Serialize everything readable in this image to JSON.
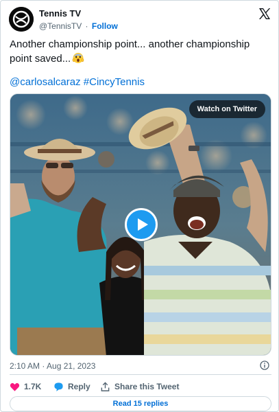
{
  "author": {
    "name": "Tennis TV",
    "handle": "@TennisTV",
    "separator": "·",
    "follow_label": "Follow"
  },
  "tweet": {
    "text_line1": "Another championship point... another championship",
    "text_line2": "point saved...",
    "emoji": "screaming-face",
    "mention": "@carlosalcaraz",
    "hashtag": "#CincyTennis"
  },
  "media": {
    "watch_label": "Watch on Twitter",
    "play_icon": "play-icon"
  },
  "meta": {
    "timestamp": "2:10 AM · Aug 21, 2023"
  },
  "actions": {
    "like_count": "1.7K",
    "reply_label": "Reply",
    "share_label": "Share this Tweet"
  },
  "footer": {
    "read_replies_label": "Read 15 replies"
  },
  "colors": {
    "link": "#006fd6",
    "like": "#f91880",
    "play": "#1d9bf0",
    "text": "#0f1419",
    "muted": "#536471",
    "border": "#cfd9de"
  }
}
